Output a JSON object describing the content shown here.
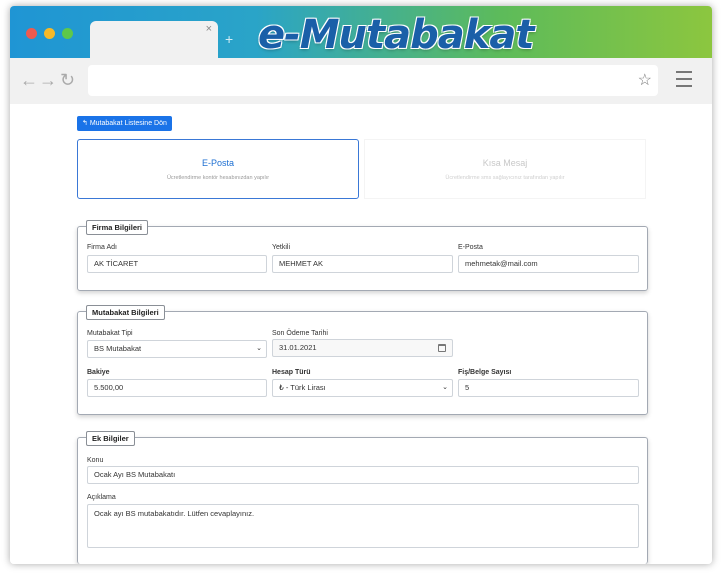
{
  "browser": {
    "brand": "e-Mutabakat",
    "tab_close": "×",
    "tab_new": "+",
    "nav_back": "←",
    "nav_forward": "→",
    "nav_reload": "↻",
    "star": "☆"
  },
  "page": {
    "back_button": "Mutabakat Listesine Dön",
    "back_icon": "↰"
  },
  "channels": [
    {
      "title": "E-Posta",
      "subtitle": "Ücretlendirme kontör hesabınızdan yapılır"
    },
    {
      "title": "Kısa Mesaj",
      "subtitle": "Ücretlendirme sms sağlayıcınız tarafından yapılır"
    }
  ],
  "firma": {
    "legend": "Firma Bilgileri",
    "firma_adi_label": "Firma Adı",
    "firma_adi_value": "AK TİCARET",
    "yetkili_label": "Yetkili",
    "yetkili_value": "MEHMET AK",
    "eposta_label": "E-Posta",
    "eposta_value": "mehmetak@mail.com"
  },
  "mutabakat": {
    "legend": "Mutabakat Bilgileri",
    "tipi_label": "Mutabakat Tipi",
    "tipi_value": "BS Mutabakat",
    "son_odeme_label": "Son Ödeme Tarihi",
    "son_odeme_value": "31.01.2021",
    "bakiye_label": "Bakiye",
    "bakiye_value": "5.500,00",
    "hesap_turu_label": "Hesap Türü",
    "hesap_turu_value": "₺ - Türk Lirası",
    "fis_label": "Fiş/Belge Sayısı",
    "fis_value": "5"
  },
  "ek": {
    "legend": "Ek Bilgiler",
    "konu_label": "Konu",
    "konu_value": "Ocak Ayı BS Mutabakatı",
    "aciklama_label": "Açıklama",
    "aciklama_value": "Ocak ayı BS mutabakatıdır. Lütfen cevaplayınız."
  },
  "icons": {
    "chevron": "⌄"
  }
}
